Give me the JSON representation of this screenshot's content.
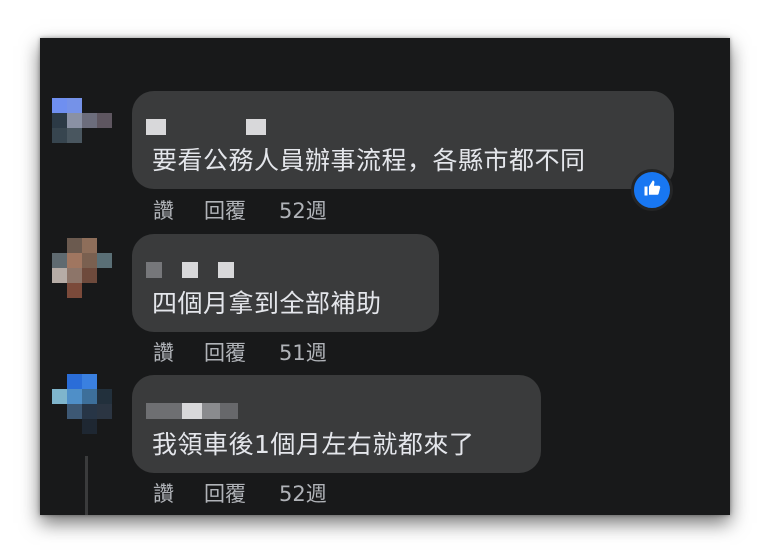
{
  "comments": [
    {
      "text": "要看公務人員辦事流程，各縣市都不同",
      "actions": {
        "like": "讚",
        "reply": "回覆",
        "time": "52週"
      },
      "reaction_icon": "thumbs-up-icon"
    },
    {
      "text": "四個月拿到全部補助",
      "actions": {
        "like": "讚",
        "reply": "回覆",
        "time": "51週"
      }
    },
    {
      "text": "我領車後1個月左右就都來了",
      "actions": {
        "like": "讚",
        "reply": "回覆",
        "time": "52週"
      }
    }
  ],
  "colors": {
    "panel_bg": "#18191a",
    "bubble_bg": "#3a3b3c",
    "text": "#e4e6eb",
    "secondary_text": "#b0b3b8",
    "like_blue": "#1877f2"
  }
}
